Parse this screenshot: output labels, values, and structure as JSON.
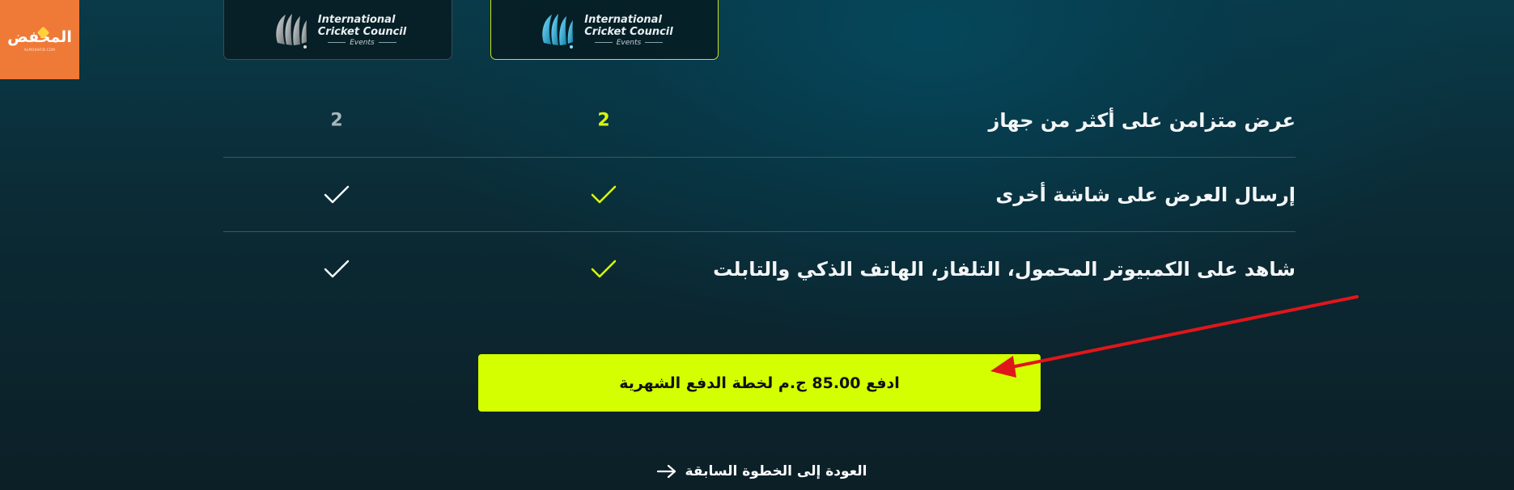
{
  "corner_logo": {
    "text": "المخفض",
    "sub": "ALMOKHFID.COM"
  },
  "plans": [
    {
      "id": "basic",
      "brand": {
        "line1": "International",
        "line2": "Cricket Council",
        "line3": "Events"
      }
    },
    {
      "id": "premium",
      "brand": {
        "line1": "International",
        "line2": "Cricket Council",
        "line3": "Events"
      }
    }
  ],
  "features": [
    {
      "label": "عرض متزامن على أكثر من جهاز",
      "basic": "2",
      "premium": "2"
    },
    {
      "label": "إرسال العرض على شاشة أخرى",
      "basic": "check-icon",
      "premium": "check-icon"
    },
    {
      "label": "شاهد على الكمبيوتر المحمول، التلفاز، الهاتف الذكي والتابلت",
      "basic": "check-icon",
      "premium": "check-icon"
    }
  ],
  "pay_button": {
    "label": "ادفع 85.00 ج.م لخطة الدفع الشهرية"
  },
  "back_link": {
    "label": "العودة إلى الخطوة السابقة"
  },
  "colors": {
    "accent": "#d4ff00",
    "premium_highlight": "#d6f70e",
    "basic_muted": "#a9b6ba",
    "annotation": "#e0161b",
    "logo_bg": "#ef7a38"
  }
}
